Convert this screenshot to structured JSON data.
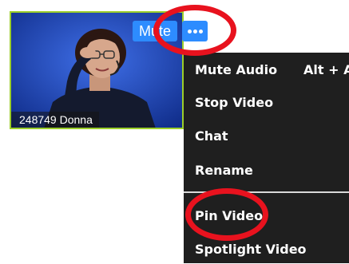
{
  "tile": {
    "participant_label": "248749 Donna",
    "mute_label": "Mute",
    "more_icon": "ellipsis-icon",
    "border_color": "#9ccf2a",
    "button_color": "#2d8cff"
  },
  "menu": {
    "items": [
      {
        "label": "Mute Audio",
        "shortcut": "Alt + A"
      },
      {
        "label": "Stop Video"
      },
      {
        "label": "Chat"
      },
      {
        "label": "Rename"
      },
      {
        "label": "Pin Video"
      },
      {
        "label": "Spotlight Video"
      }
    ]
  },
  "annotations": {
    "highlight_color": "#e8121e",
    "highlighted": [
      "more-options-button",
      "menu-item-pin-video"
    ]
  }
}
